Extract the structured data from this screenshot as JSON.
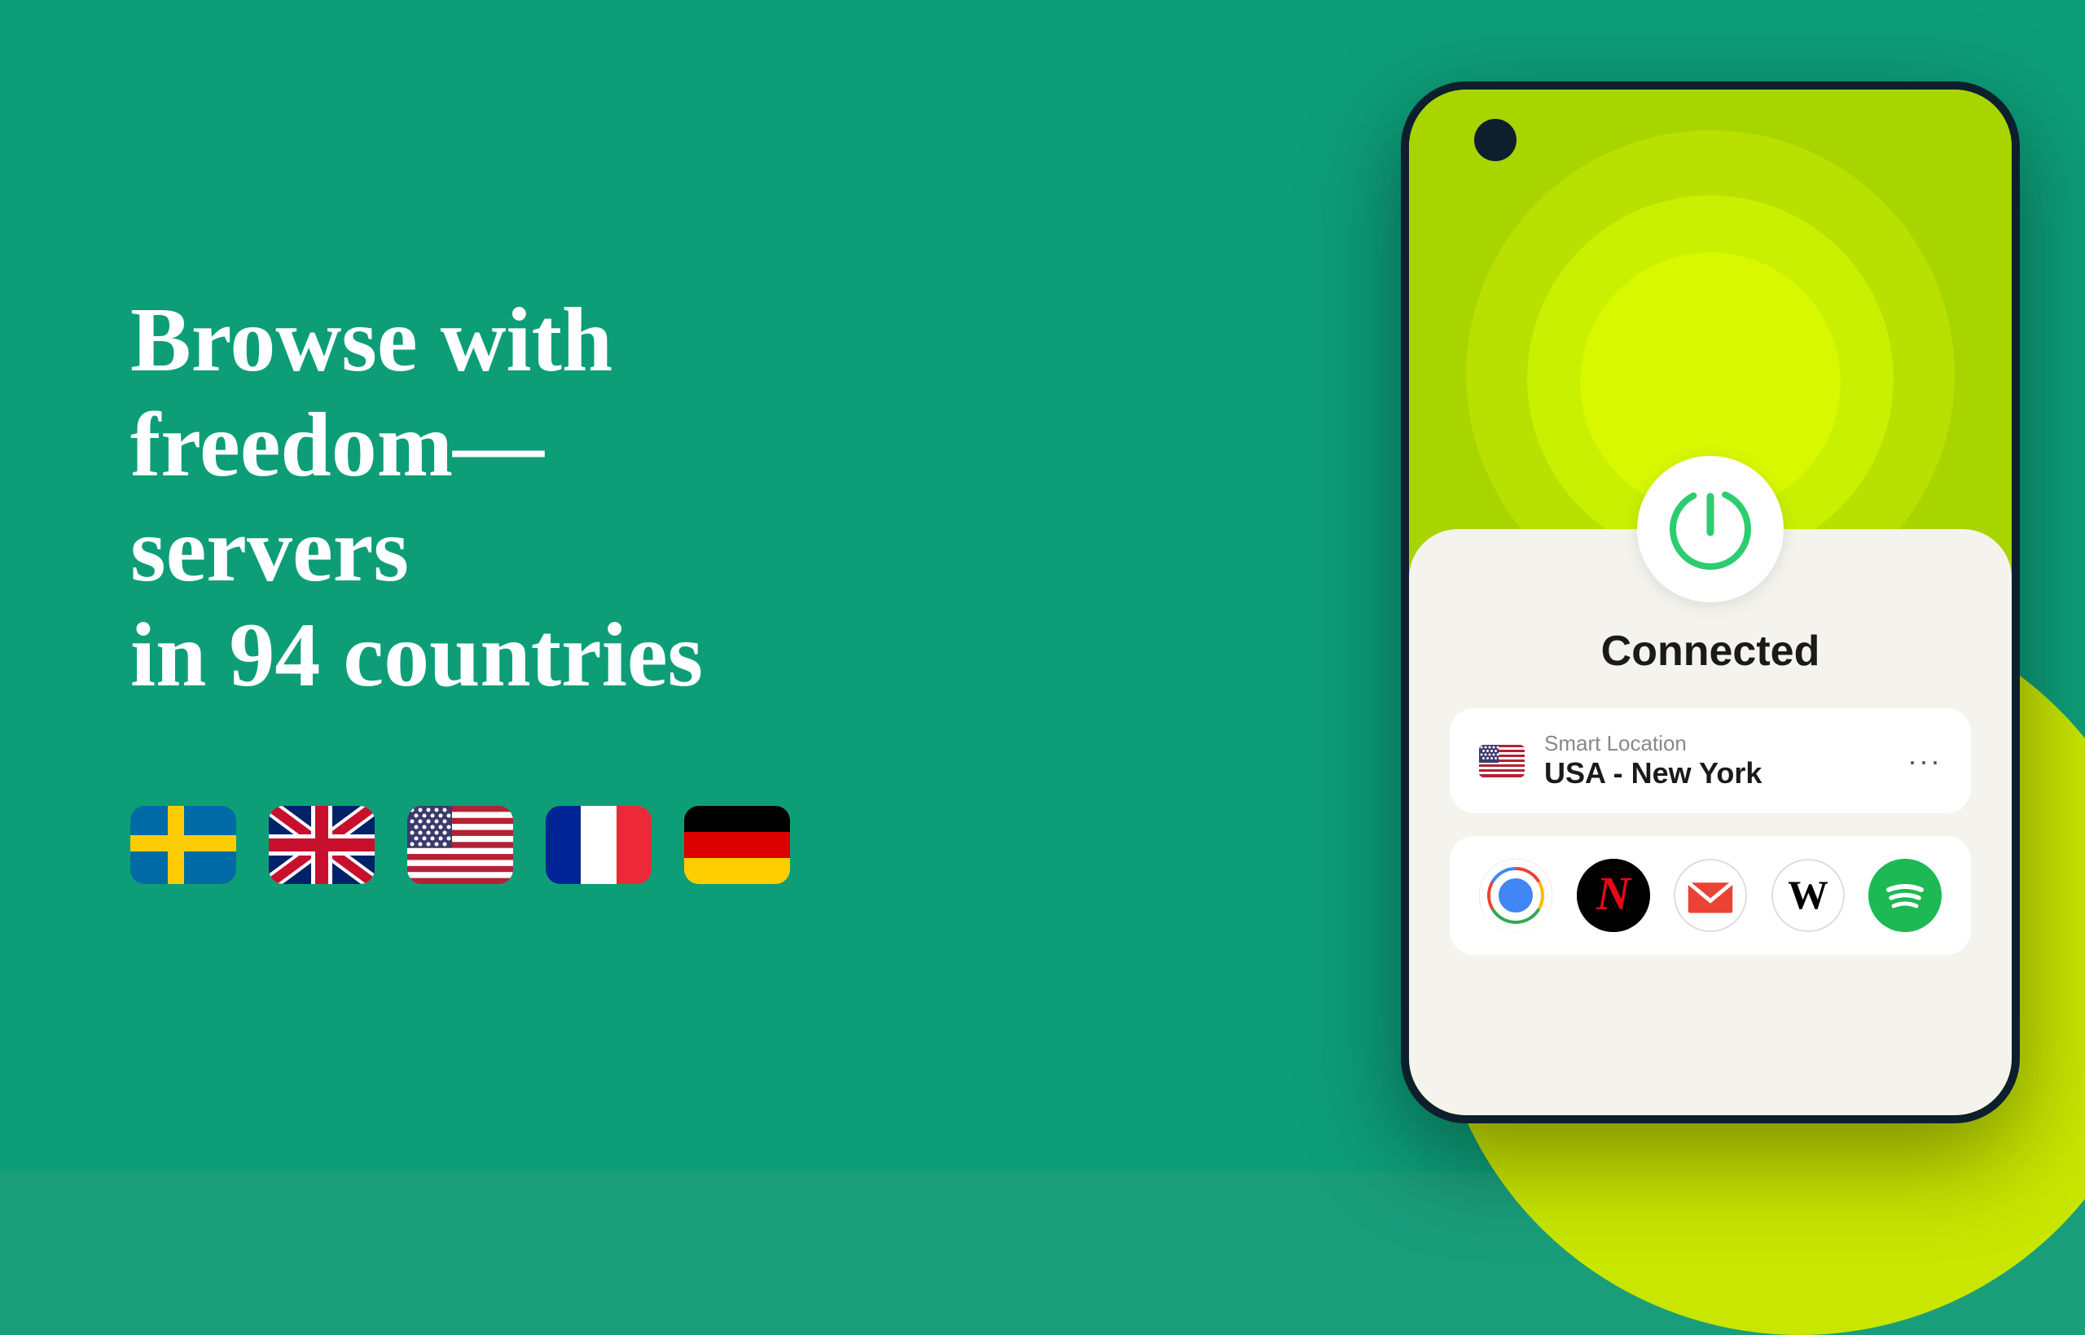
{
  "background": {
    "color": "#0d9e78"
  },
  "headline": {
    "line1": "Browse with",
    "line2": "freedom— servers",
    "line3": "in 94 countries",
    "full": "Browse with freedom— servers in 94 countries"
  },
  "flags": [
    {
      "name": "Sweden",
      "id": "sweden"
    },
    {
      "name": "United Kingdom",
      "id": "uk"
    },
    {
      "name": "United States",
      "id": "us"
    },
    {
      "name": "France",
      "id": "france"
    },
    {
      "name": "Germany",
      "id": "germany"
    }
  ],
  "phone": {
    "status": "Connected",
    "location": {
      "label": "Smart Location",
      "value": "USA - New York",
      "flag": "us"
    },
    "apps": [
      {
        "name": "Chrome",
        "id": "chrome"
      },
      {
        "name": "Netflix",
        "id": "netflix",
        "letter": "N"
      },
      {
        "name": "Gmail",
        "id": "gmail"
      },
      {
        "name": "Wikipedia",
        "id": "wikipedia",
        "letter": "W"
      },
      {
        "name": "Spotify",
        "id": "spotify"
      }
    ],
    "more_options_label": "···"
  }
}
